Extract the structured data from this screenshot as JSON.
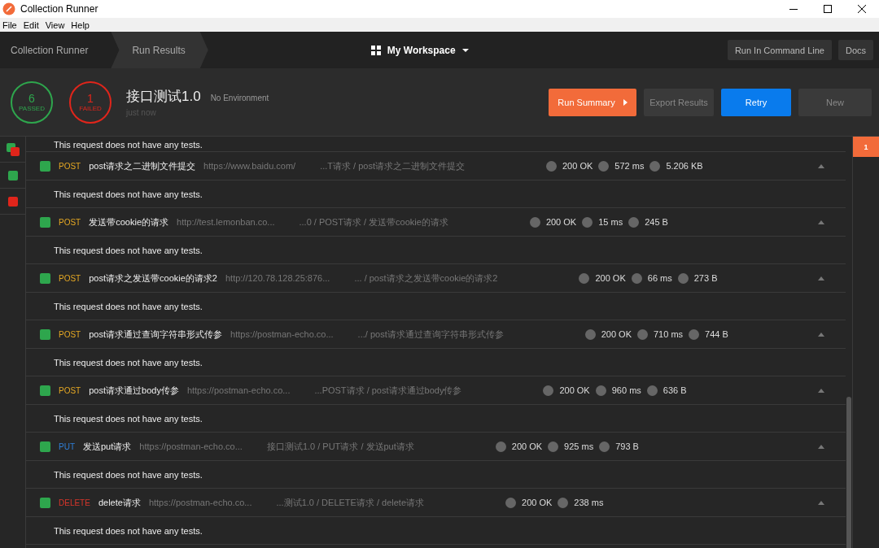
{
  "window": {
    "title": "Collection Runner"
  },
  "menu": [
    "File",
    "Edit",
    "View",
    "Help"
  ],
  "breadcrumbs": [
    {
      "label": "Collection Runner",
      "selected": false
    },
    {
      "label": "Run Results",
      "selected": true
    }
  ],
  "workspace": "My Workspace",
  "nav_buttons": [
    "Run In Command Line",
    "Docs"
  ],
  "summary": {
    "passed": {
      "count": "6",
      "label": "PASSED"
    },
    "failed": {
      "count": "1",
      "label": "FAILED"
    },
    "collection": "接口测试1.0",
    "environment": "No Environment",
    "time": "just now"
  },
  "actions": [
    {
      "label": "Run Summary",
      "kind": "primary"
    },
    {
      "label": "Export Results",
      "kind": "muted"
    },
    {
      "label": "Retry",
      "kind": "accent"
    },
    {
      "label": "New",
      "kind": "muted"
    }
  ],
  "sidebar": [
    {
      "kind": "mixed"
    },
    {
      "kind": "passed"
    },
    {
      "kind": "failed"
    }
  ],
  "iteration_badge": "1",
  "top_message": "This request does not have any tests.",
  "requests": [
    {
      "passed": true,
      "method": "POST",
      "color": "#e5a823",
      "name": "post请求之二进制文件提交",
      "url": "https://www.baidu.com/",
      "path": "...T请求 / post请求之二进制文件提交",
      "status": "200 OK",
      "time": "572 ms",
      "size": "5.206 KB",
      "message": "This request does not have any tests."
    },
    {
      "passed": true,
      "method": "POST",
      "color": "#e5a823",
      "name": "发送带cookie的请求",
      "url": "http://test.lemonban.co...",
      "path": "...0 / POST请求 / 发送带cookie的请求",
      "status": "200 OK",
      "time": "15 ms",
      "size": "245 B",
      "message": "This request does not have any tests."
    },
    {
      "passed": true,
      "method": "POST",
      "color": "#e5a823",
      "name": "post请求之发送带cookie的请求2",
      "url": "http://120.78.128.25:876...",
      "path": "... / post请求之发送带cookie的请求2",
      "status": "200 OK",
      "time": "66 ms",
      "size": "273 B",
      "message": "This request does not have any tests."
    },
    {
      "passed": true,
      "method": "POST",
      "color": "#e5a823",
      "name": "post请求通过查询字符串形式传参",
      "url": "https://postman-echo.co...",
      "path": ".../ post请求通过查询字符串形式传参",
      "status": "200 OK",
      "time": "710 ms",
      "size": "744 B",
      "message": "This request does not have any tests."
    },
    {
      "passed": true,
      "method": "POST",
      "color": "#e5a823",
      "name": "post请求通过body传参",
      "url": "https://postman-echo.co...",
      "path": "...POST请求 / post请求通过body传参",
      "status": "200 OK",
      "time": "960 ms",
      "size": "636 B",
      "message": "This request does not have any tests."
    },
    {
      "passed": true,
      "method": "PUT",
      "color": "#2f7fd8",
      "name": "发送put请求",
      "url": "https://postman-echo.co...",
      "path": "接口测试1.0 / PUT请求 / 发送put请求",
      "status": "200 OK",
      "time": "925 ms",
      "size": "793 B",
      "message": "This request does not have any tests."
    },
    {
      "passed": true,
      "method": "DELETE",
      "color": "#d9352b",
      "name": "delete请求",
      "url": "https://postman-echo.co...",
      "path": "...测试1.0 / DELETE请求 / delete请求",
      "status": "200 OK",
      "time": "238 ms",
      "message": "This request does not have any tests."
    }
  ]
}
